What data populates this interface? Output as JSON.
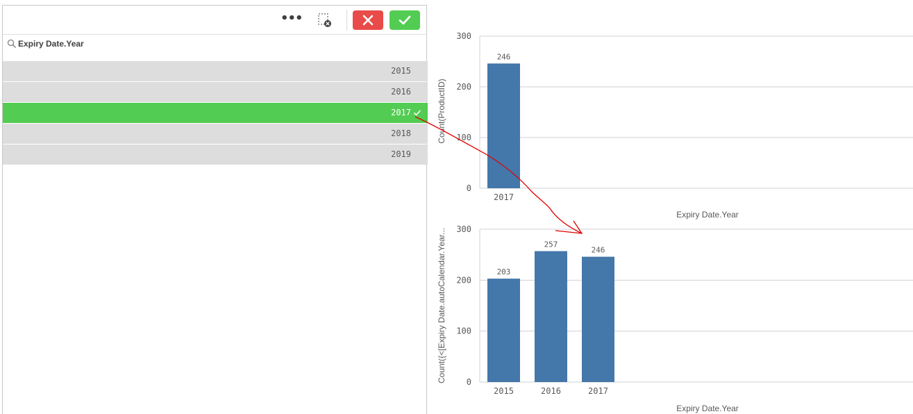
{
  "filter_pane": {
    "field_title": "Expiry Date.Year",
    "items": [
      {
        "label": "2015",
        "selected": false
      },
      {
        "label": "2016",
        "selected": false
      },
      {
        "label": "2017",
        "selected": true
      },
      {
        "label": "2018",
        "selected": false
      },
      {
        "label": "2019",
        "selected": false
      }
    ]
  },
  "colors": {
    "bar": "#4477aa",
    "selected": "#52cc52",
    "excluded_row": "#dddddd",
    "cancel": "#e84b49",
    "confirm": "#52cc52",
    "annotation": "#e00000"
  },
  "icons": [
    "more-icon",
    "clear-selections-icon",
    "close-icon",
    "checkmark-icon",
    "search-icon"
  ],
  "chart_data": [
    {
      "type": "bar",
      "categories": [
        "2017"
      ],
      "values": [
        246
      ],
      "xlabel": "Expiry Date.Year",
      "ylabel": "Count(ProductID)",
      "ylim": [
        0,
        300
      ],
      "yticks": [
        0,
        100,
        200,
        300
      ],
      "grid": true
    },
    {
      "type": "bar",
      "categories": [
        "2015",
        "2016",
        "2017"
      ],
      "values": [
        203,
        257,
        246
      ],
      "xlabel": "Expiry Date.Year",
      "ylabel": "Count({<[Expiry Date.autoCalendar.Year...",
      "ylim": [
        0,
        300
      ],
      "yticks": [
        0,
        100,
        200,
        300
      ],
      "grid": true
    }
  ]
}
